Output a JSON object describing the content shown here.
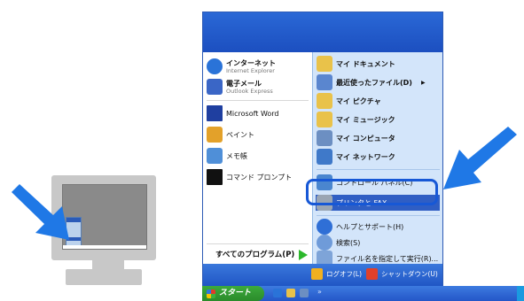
{
  "start_menu": {
    "pinned": [
      {
        "label": "インターネット",
        "sublabel": "Internet Explorer",
        "icon": "internet-explorer-icon",
        "color": "#2a73d8"
      },
      {
        "label": "電子メール",
        "sublabel": "Outlook Express",
        "icon": "outlook-express-icon",
        "color": "#3a66c6"
      }
    ],
    "recent": [
      {
        "label": "Microsoft Word",
        "icon": "word-icon",
        "color": "#1f3fa0"
      },
      {
        "label": "ペイント",
        "icon": "paint-icon",
        "color": "#e3a12a"
      },
      {
        "label": "メモ帳",
        "icon": "notepad-icon",
        "color": "#4f8fd8"
      },
      {
        "label": "コマンド プロンプト",
        "icon": "command-prompt-icon",
        "color": "#111111"
      }
    ],
    "all_programs_label": "すべてのプログラム(P)",
    "right_items": [
      {
        "label": "マイ ドキュメント",
        "icon": "my-documents-icon",
        "color": "#e9c24a"
      },
      {
        "label": "最近使ったファイル(D)",
        "icon": "recent-documents-icon",
        "color": "#5a86cf",
        "has_submenu": true
      },
      {
        "label": "マイ ピクチャ",
        "icon": "my-pictures-icon",
        "color": "#e9c24a"
      },
      {
        "label": "マイ ミュージック",
        "icon": "my-music-icon",
        "color": "#e9c24a"
      },
      {
        "label": "マイ コンピュータ",
        "icon": "my-computer-icon",
        "color": "#6c8fc2"
      },
      {
        "label": "マイ ネットワーク",
        "icon": "my-network-icon",
        "color": "#3f79c9"
      },
      {
        "label": "コントロール パネル(C)",
        "icon": "control-panel-icon",
        "color": "#4a86cf"
      },
      {
        "label": "プリンタと FAX",
        "icon": "printers-and-faxes-icon",
        "color": "#9aa5b3",
        "selected": true
      },
      {
        "label": "ヘルプとサポート(H)",
        "icon": "help-icon",
        "color": "#2f6fd6"
      },
      {
        "label": "検索(S)",
        "icon": "search-icon",
        "color": "#6f9bd9"
      },
      {
        "label": "ファイル名を指定して実行(R)...",
        "icon": "run-icon",
        "color": "#7ea4d8"
      }
    ],
    "footer": {
      "logoff_label": "ログオフ(L)",
      "shutdown_label": "シャットダウン(U)"
    }
  },
  "taskbar": {
    "start_label": "スタート",
    "overflow_label": "»"
  },
  "colors": {
    "accent": "#1758d6",
    "arrow": "#1f78e6",
    "selection": "#2f5ec4"
  }
}
